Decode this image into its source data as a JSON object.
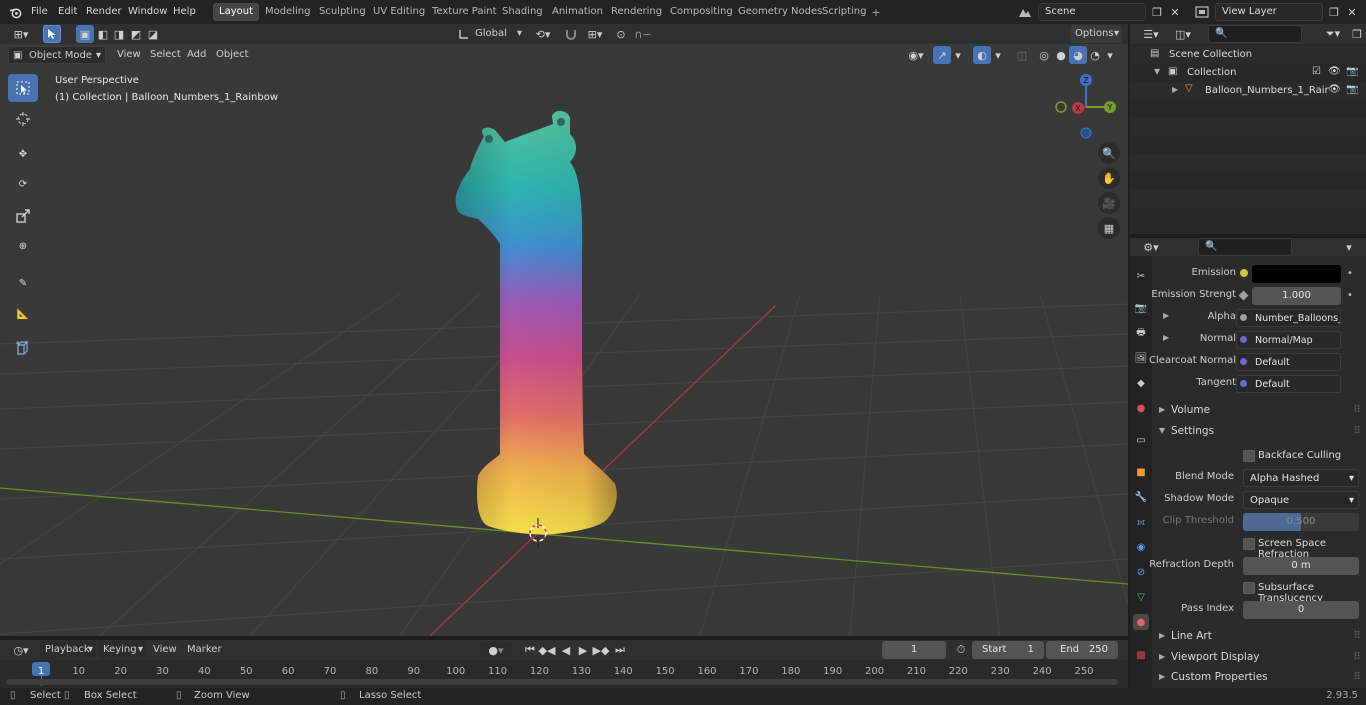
{
  "topbar": {
    "menus": [
      "File",
      "Edit",
      "Render",
      "Window",
      "Help"
    ],
    "workspaces": [
      "Layout",
      "Modeling",
      "Sculpting",
      "UV Editing",
      "Texture Paint",
      "Shading",
      "Animation",
      "Rendering",
      "Compositing",
      "Geometry Nodes",
      "Scripting"
    ],
    "active_workspace": "Layout",
    "scene": "Scene",
    "view_layer": "View Layer"
  },
  "toolheader": {
    "transform_orientation": "Global",
    "options": "Options"
  },
  "viewport_header": {
    "mode": "Object Mode",
    "menus": [
      "View",
      "Select",
      "Add",
      "Object"
    ]
  },
  "viewport": {
    "perspective": "User Perspective",
    "collection_info": "(1) Collection | Balloon_Numbers_1_Rainbow",
    "gizmo": {
      "z": "Z",
      "y": "Y",
      "x": "X"
    }
  },
  "outliner": {
    "scene_collection": "Scene Collection",
    "collection": "Collection",
    "object": "Balloon_Numbers_1_Rair"
  },
  "properties": {
    "emission_label": "Emission",
    "emission_strength_label": "Emission Strengt",
    "emission_strength_value": "1.000",
    "alpha_label": "Alpha",
    "alpha_value": "Number_Balloons_1...",
    "normal_label": "Normal",
    "normal_value": "Normal/Map",
    "clearcoat_label": "Clearcoat Normal",
    "clearcoat_value": "Default",
    "tangent_label": "Tangent",
    "tangent_value": "Default",
    "volume": "Volume",
    "settings": "Settings",
    "backface": "Backface Culling",
    "blend_label": "Blend Mode",
    "blend_value": "Alpha Hashed",
    "shadow_label": "Shadow Mode",
    "shadow_value": "Opaque",
    "clip_label": "Clip Threshold",
    "clip_value": "0.500",
    "ssr": "Screen Space Refraction",
    "refr_label": "Refraction Depth",
    "refr_value": "0 m",
    "sss": "Subsurface Translucency",
    "pass_label": "Pass Index",
    "pass_value": "0",
    "line_art": "Line Art",
    "viewport_display": "Viewport Display",
    "custom_props": "Custom Properties"
  },
  "timeline": {
    "menus": [
      "Playback",
      "Keying",
      "View",
      "Marker"
    ],
    "current_frame": "1",
    "start_label": "Start",
    "start": "1",
    "end_label": "End",
    "end": "250",
    "ticks": [
      "1",
      "10",
      "20",
      "30",
      "40",
      "50",
      "60",
      "70",
      "80",
      "90",
      "100",
      "110",
      "120",
      "130",
      "140",
      "150",
      "160",
      "170",
      "180",
      "190",
      "200",
      "210",
      "220",
      "230",
      "240",
      "250"
    ]
  },
  "statusbar": {
    "select": "Select",
    "box_select": "Box Select",
    "zoom_view": "Zoom View",
    "lasso_select": "Lasso Select",
    "version": "2.93.5"
  },
  "colors": {
    "accent": "#4772b3",
    "x_axis": "#b83a46",
    "y_axis": "#7a9a2c",
    "z_axis": "#3a74c4"
  }
}
